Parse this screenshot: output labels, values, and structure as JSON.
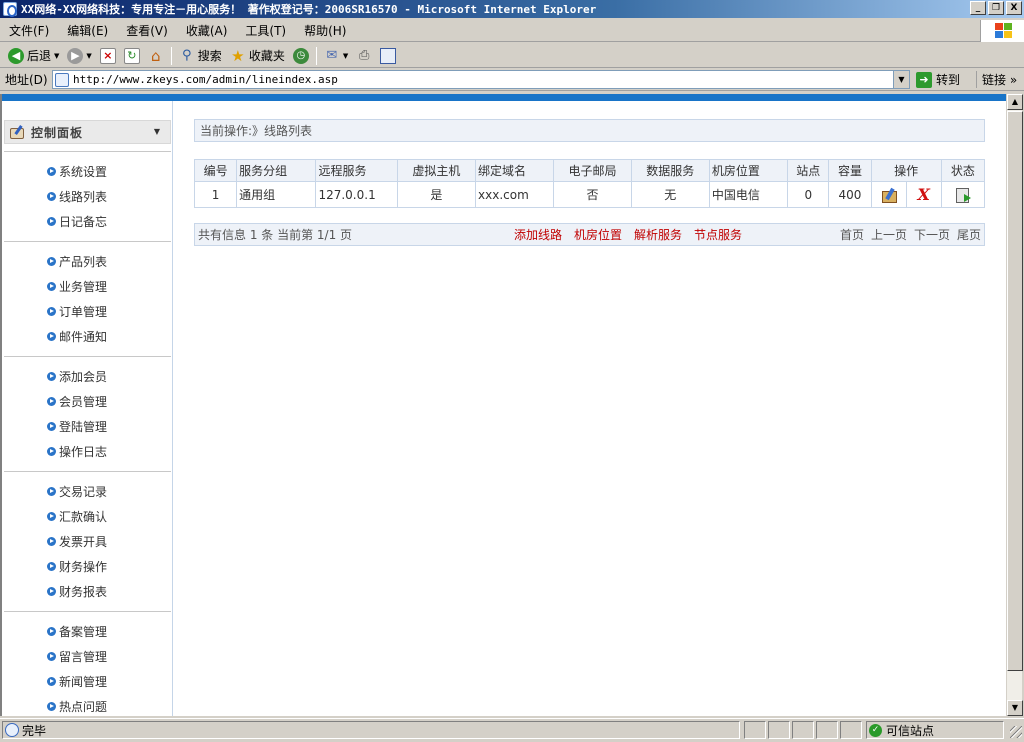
{
  "window": {
    "title": "XX网络-XX网络科技：专用专注－用心服务！ 著作权登记号：2006SR16570 - Microsoft Internet Explorer",
    "min_label": "_",
    "max_label": "❐",
    "close_label": "X"
  },
  "menubar": {
    "items": [
      "文件(F)",
      "编辑(E)",
      "查看(V)",
      "收藏(A)",
      "工具(T)",
      "帮助(H)"
    ]
  },
  "toolbar": {
    "back": "后退",
    "search": "搜索",
    "favorites": "收藏夹"
  },
  "address": {
    "label": "地址(D)",
    "url": "http://www.zkeys.com/admin/lineindex.asp",
    "go": "转到",
    "links": "链接 »"
  },
  "sidebar": {
    "title": "控制面板",
    "groups": [
      [
        "系统设置",
        "线路列表",
        "日记备忘"
      ],
      [
        "产品列表",
        "业务管理",
        "订单管理",
        "邮件通知"
      ],
      [
        "添加会员",
        "会员管理",
        "登陆管理",
        "操作日志"
      ],
      [
        "交易记录",
        "汇款确认",
        "发票开具",
        "财务操作",
        "财务报表"
      ],
      [
        "备案管理",
        "留言管理",
        "新闻管理",
        "热点问题"
      ]
    ]
  },
  "main": {
    "breadcrumb": "当前操作:》线路列表",
    "table": {
      "headers": [
        "编号",
        "服务分组",
        "远程服务",
        "虚拟主机",
        "绑定域名",
        "电子邮局",
        "数据服务",
        "机房位置",
        "站点",
        "容量",
        "操作",
        "状态"
      ],
      "rows": [
        [
          "1",
          "通用组",
          "127.0.0.1",
          "是",
          "xxx.com",
          "否",
          "无",
          "中国电信",
          "0",
          "400"
        ]
      ]
    },
    "pager": {
      "info": "共有信息 1 条 当前第 1/1 页",
      "actions": [
        "添加线路",
        "机房位置",
        "解析服务",
        "节点服务"
      ],
      "pages": [
        "首页",
        "上一页",
        "下一页",
        "尾页"
      ]
    }
  },
  "statusbar": {
    "text": "完毕",
    "zone": "可信站点"
  }
}
